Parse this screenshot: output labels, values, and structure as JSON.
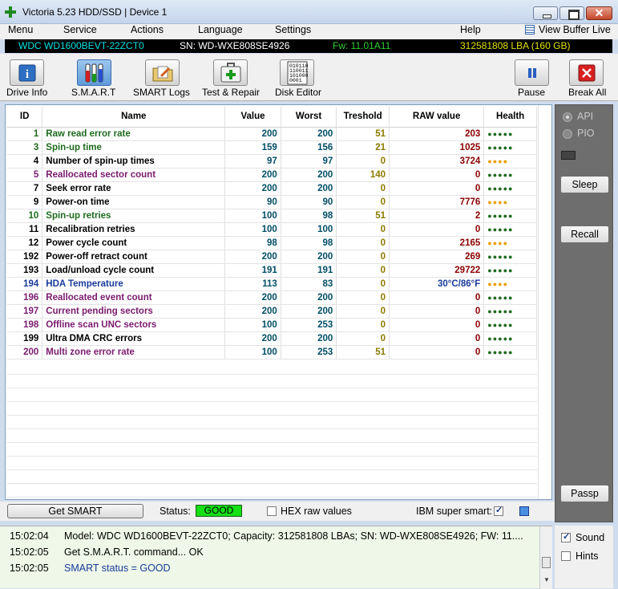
{
  "window": {
    "title": "Victoria 5.23 HDD/SSD | Device 1"
  },
  "menu": {
    "items": [
      "Menu",
      "Service",
      "Actions",
      "Language",
      "Settings",
      "Help"
    ],
    "view_buffer": "View Buffer Live"
  },
  "device": {
    "model": "WDC WD1600BEVT-22ZCT0",
    "serial": "SN: WD-WXE808SE4926",
    "firmware": "Fw: 11.01A11",
    "capacity": "312581808 LBA (160 GB)"
  },
  "toolbar": {
    "drive_info": "Drive Info",
    "smart": "S.M.A.R.T",
    "smart_logs": "SMART Logs",
    "test_repair": "Test & Repair",
    "disk_editor": "Disk Editor",
    "disk_editor_icon_text": "010110\n110011\n101000\n0001",
    "pause": "Pause",
    "break_all": "Break All"
  },
  "table": {
    "headers": [
      "ID",
      "Name",
      "Value",
      "Worst",
      "Treshold",
      "RAW value",
      "Health"
    ],
    "rows": [
      {
        "id": "1",
        "name": "Raw read error rate",
        "value": "200",
        "worst": "200",
        "tres": "51",
        "raw": "203",
        "health": "●●●●●",
        "color": "#1e6b1e",
        "hcolor": "#1e6b1e"
      },
      {
        "id": "3",
        "name": "Spin-up time",
        "value": "159",
        "worst": "156",
        "tres": "21",
        "raw": "1025",
        "health": "●●●●●",
        "color": "#1e6b1e",
        "hcolor": "#1e6b1e"
      },
      {
        "id": "4",
        "name": "Number of spin-up times",
        "value": "97",
        "worst": "97",
        "tres": "0",
        "raw": "3724",
        "health": "●●●●",
        "color": "#000000",
        "hcolor": "#e8a000"
      },
      {
        "id": "5",
        "name": "Reallocated sector count",
        "value": "200",
        "worst": "200",
        "tres": "140",
        "raw": "0",
        "health": "●●●●●",
        "color": "#7a1a6e",
        "hcolor": "#1e6b1e"
      },
      {
        "id": "7",
        "name": "Seek error rate",
        "value": "200",
        "worst": "200",
        "tres": "0",
        "raw": "0",
        "health": "●●●●●",
        "color": "#000000",
        "hcolor": "#1e6b1e"
      },
      {
        "id": "9",
        "name": "Power-on time",
        "value": "90",
        "worst": "90",
        "tres": "0",
        "raw": "7776",
        "health": "●●●●",
        "color": "#000000",
        "hcolor": "#e8a000"
      },
      {
        "id": "10",
        "name": "Spin-up retries",
        "value": "100",
        "worst": "98",
        "tres": "51",
        "raw": "2",
        "health": "●●●●●",
        "color": "#1e6b1e",
        "hcolor": "#1e6b1e"
      },
      {
        "id": "11",
        "name": "Recalibration retries",
        "value": "100",
        "worst": "100",
        "tres": "0",
        "raw": "0",
        "health": "●●●●●",
        "color": "#000000",
        "hcolor": "#1e6b1e"
      },
      {
        "id": "12",
        "name": "Power cycle count",
        "value": "98",
        "worst": "98",
        "tres": "0",
        "raw": "2165",
        "health": "●●●●",
        "color": "#000000",
        "hcolor": "#e8a000"
      },
      {
        "id": "192",
        "name": "Power-off retract count",
        "value": "200",
        "worst": "200",
        "tres": "0",
        "raw": "269",
        "health": "●●●●●",
        "color": "#000000",
        "hcolor": "#1e6b1e"
      },
      {
        "id": "193",
        "name": "Load/unload cycle count",
        "value": "191",
        "worst": "191",
        "tres": "0",
        "raw": "29722",
        "health": "●●●●●",
        "color": "#000000",
        "hcolor": "#1e6b1e"
      },
      {
        "id": "194",
        "name": "HDA Temperature",
        "value": "113",
        "worst": "83",
        "tres": "0",
        "raw": "30°C/86°F",
        "health": "●●●●",
        "color": "#1a3b9a",
        "hcolor": "#e8a000",
        "rawcolor": "#1a3b9a"
      },
      {
        "id": "196",
        "name": "Reallocated event count",
        "value": "200",
        "worst": "200",
        "tres": "0",
        "raw": "0",
        "health": "●●●●●",
        "color": "#7a1a6e",
        "hcolor": "#1e6b1e"
      },
      {
        "id": "197",
        "name": "Current pending sectors",
        "value": "200",
        "worst": "200",
        "tres": "0",
        "raw": "0",
        "health": "●●●●●",
        "color": "#7a1a6e",
        "hcolor": "#1e6b1e"
      },
      {
        "id": "198",
        "name": "Offline scan UNC sectors",
        "value": "100",
        "worst": "253",
        "tres": "0",
        "raw": "0",
        "health": "●●●●●",
        "color": "#7a1a6e",
        "hcolor": "#1e6b1e"
      },
      {
        "id": "199",
        "name": "Ultra DMA CRC errors",
        "value": "200",
        "worst": "200",
        "tres": "0",
        "raw": "0",
        "health": "●●●●●",
        "color": "#000000",
        "hcolor": "#1e6b1e"
      },
      {
        "id": "200",
        "name": "Multi zone error rate",
        "value": "100",
        "worst": "253",
        "tres": "51",
        "raw": "0",
        "health": "●●●●●",
        "color": "#7a1a6e",
        "hcolor": "#1e6b1e"
      }
    ]
  },
  "status_row": {
    "get_smart": "Get SMART",
    "status_label": "Status:",
    "status_value": "GOOD",
    "hex_raw": "HEX raw values",
    "ibm_smart": "IBM super smart:"
  },
  "log": [
    {
      "time": "15:02:04",
      "msg": "Model: WDC WD1600BEVT-22ZCT0; Capacity: 312581808 LBAs; SN: WD-WXE808SE4926; FW: 11....",
      "color": "#000000"
    },
    {
      "time": "15:02:05",
      "msg": "Get S.M.A.R.T. command... OK",
      "color": "#000000"
    },
    {
      "time": "15:02:05",
      "msg": "SMART status = GOOD",
      "color": "#1a3b9a"
    }
  ],
  "side": {
    "api": "API",
    "pio": "PIO",
    "sleep": "Sleep",
    "recall": "Recall",
    "passp": "Passp",
    "sound": "Sound",
    "hints": "Hints"
  },
  "colors": {
    "infobar_model": "#00e0e0",
    "infobar_serial": "#ffffff",
    "infobar_fw": "#2fd02f",
    "infobar_capacity": "#e0e000",
    "status_good": "#14e014"
  }
}
